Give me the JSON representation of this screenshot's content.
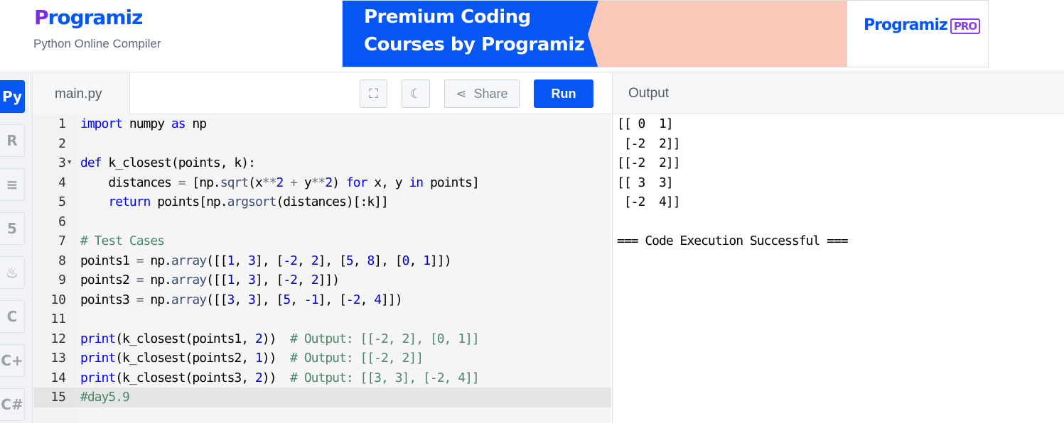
{
  "header": {
    "logo_text": "Programiz",
    "subtitle": "Python Online Compiler"
  },
  "banner": {
    "line1": "Premium Coding",
    "line2": "Courses by Programiz",
    "pro_logo": "Programiz",
    "pro_badge": "PRO"
  },
  "sidebar": {
    "items": [
      {
        "icon": "python-icon",
        "glyph": "Py",
        "active": true
      },
      {
        "icon": "r-icon",
        "glyph": "R"
      },
      {
        "icon": "database-icon",
        "glyph": "≡"
      },
      {
        "icon": "html5-icon",
        "glyph": "5"
      },
      {
        "icon": "java-icon",
        "glyph": "♨"
      },
      {
        "icon": "c-icon",
        "glyph": "C"
      },
      {
        "icon": "cpp-icon",
        "glyph": "C+"
      },
      {
        "icon": "csharp-icon",
        "glyph": "C#"
      }
    ]
  },
  "editor": {
    "tab": "main.py",
    "toolbar": {
      "fullscreen_icon": "fullscreen-icon",
      "theme_icon": "moon-icon",
      "share_label": "Share",
      "run_label": "Run"
    },
    "lines": [
      [
        [
          "k",
          "import"
        ],
        [
          "t",
          " numpy "
        ],
        [
          "k",
          "as"
        ],
        [
          "t",
          " np"
        ]
      ],
      [],
      [
        [
          "k",
          "def"
        ],
        [
          "t",
          " k_closest(points, k):"
        ]
      ],
      [
        [
          "t",
          "    distances "
        ],
        [
          "o",
          "="
        ],
        [
          "t",
          " [np."
        ],
        [
          "f",
          "sqrt"
        ],
        [
          "t",
          "(x"
        ],
        [
          "o",
          "**"
        ],
        [
          "n",
          "2"
        ],
        [
          "t",
          " "
        ],
        [
          "o",
          "+"
        ],
        [
          "t",
          " y"
        ],
        [
          "o",
          "**"
        ],
        [
          "n",
          "2"
        ],
        [
          "t",
          ") "
        ],
        [
          "k",
          "for"
        ],
        [
          "t",
          " x, y "
        ],
        [
          "k",
          "in"
        ],
        [
          "t",
          " points]"
        ]
      ],
      [
        [
          "t",
          "    "
        ],
        [
          "k",
          "return"
        ],
        [
          "t",
          " points[np."
        ],
        [
          "f",
          "argsort"
        ],
        [
          "t",
          "(distances)[:k]]"
        ]
      ],
      [],
      [
        [
          "c",
          "# Test Cases"
        ]
      ],
      [
        [
          "t",
          "points1 "
        ],
        [
          "o",
          "="
        ],
        [
          "t",
          " np."
        ],
        [
          "f",
          "array"
        ],
        [
          "t",
          "([["
        ],
        [
          "n",
          "1"
        ],
        [
          "t",
          ", "
        ],
        [
          "n",
          "3"
        ],
        [
          "t",
          "], ["
        ],
        [
          "n",
          "-2"
        ],
        [
          "t",
          ", "
        ],
        [
          "n",
          "2"
        ],
        [
          "t",
          "], ["
        ],
        [
          "n",
          "5"
        ],
        [
          "t",
          ", "
        ],
        [
          "n",
          "8"
        ],
        [
          "t",
          "], ["
        ],
        [
          "n",
          "0"
        ],
        [
          "t",
          ", "
        ],
        [
          "n",
          "1"
        ],
        [
          "t",
          "]])"
        ]
      ],
      [
        [
          "t",
          "points2 "
        ],
        [
          "o",
          "="
        ],
        [
          "t",
          " np."
        ],
        [
          "f",
          "array"
        ],
        [
          "t",
          "([["
        ],
        [
          "n",
          "1"
        ],
        [
          "t",
          ", "
        ],
        [
          "n",
          "3"
        ],
        [
          "t",
          "], ["
        ],
        [
          "n",
          "-2"
        ],
        [
          "t",
          ", "
        ],
        [
          "n",
          "2"
        ],
        [
          "t",
          "]])"
        ]
      ],
      [
        [
          "t",
          "points3 "
        ],
        [
          "o",
          "="
        ],
        [
          "t",
          " np."
        ],
        [
          "f",
          "array"
        ],
        [
          "t",
          "([["
        ],
        [
          "n",
          "3"
        ],
        [
          "t",
          ", "
        ],
        [
          "n",
          "3"
        ],
        [
          "t",
          "], ["
        ],
        [
          "n",
          "5"
        ],
        [
          "t",
          ", "
        ],
        [
          "n",
          "-1"
        ],
        [
          "t",
          "], ["
        ],
        [
          "n",
          "-2"
        ],
        [
          "t",
          ", "
        ],
        [
          "n",
          "4"
        ],
        [
          "t",
          "]])"
        ]
      ],
      [],
      [
        [
          "k",
          "print"
        ],
        [
          "t",
          "(k_closest(points1, "
        ],
        [
          "n",
          "2"
        ],
        [
          "t",
          "))  "
        ],
        [
          "c",
          "# Output: [[-2, 2], [0, 1]]"
        ]
      ],
      [
        [
          "k",
          "print"
        ],
        [
          "t",
          "(k_closest(points2, "
        ],
        [
          "n",
          "1"
        ],
        [
          "t",
          "))  "
        ],
        [
          "c",
          "# Output: [[-2, 2]]"
        ]
      ],
      [
        [
          "k",
          "print"
        ],
        [
          "t",
          "(k_closest(points3, "
        ],
        [
          "n",
          "2"
        ],
        [
          "t",
          "))  "
        ],
        [
          "c",
          "# Output: [[3, 3], [-2, 4]]"
        ]
      ],
      [
        [
          "c",
          "#day5.9"
        ]
      ]
    ],
    "active_line": 15,
    "fold_line": 3
  },
  "output": {
    "title": "Output",
    "text": "[[ 0  1]\n [-2  2]]\n[[-2  2]]\n[[ 3  3]\n [-2  4]]\n\n=== Code Execution Successful ==="
  }
}
